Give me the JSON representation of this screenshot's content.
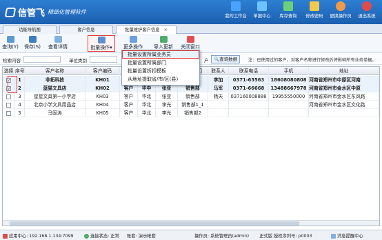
{
  "brand": {
    "name": "信管飞",
    "subtitle": "精细化管理软件"
  },
  "topnav": [
    {
      "label": "我的工作台",
      "icon": "desktop-icon",
      "color": "#4aa3ff"
    },
    {
      "label": "单据中心",
      "icon": "documents-icon",
      "color": "#6cc3ff"
    },
    {
      "label": "库存查询",
      "icon": "stock-icon",
      "color": "#6bd07a"
    },
    {
      "label": "修改密码",
      "icon": "lock-icon",
      "color": "#f2c94c"
    },
    {
      "label": "更换操作员",
      "icon": "user-icon",
      "color": "#f29a4c"
    },
    {
      "label": "退出系统",
      "icon": "exit-icon",
      "color": "#e04b4b"
    }
  ],
  "tabs": [
    {
      "label": "功能导航图"
    },
    {
      "label": "客户信息"
    },
    {
      "label": "批量维护客户信息",
      "close": "×"
    }
  ],
  "toolbar": {
    "query": "查询(Y)",
    "save": "保存(S)",
    "detail": "查看详情",
    "batch": "批量操作",
    "more": "更多操作",
    "import": "导入更新",
    "close": "关闭窗口"
  },
  "dropdown": [
    "批量设置所属业务员",
    "批量设置所属部门",
    "批量设置折扣模板",
    "从地址提取省/市/区(县)"
  ],
  "search": {
    "label_keyword": "检索内容",
    "label_unit": "单位类别",
    "label_dept": "户",
    "query_button": "查询数据",
    "note": "注：已使用过的客户，对客户名称进行修改后将影响所有业务单据。"
  },
  "table": {
    "headers": [
      "选择",
      "序号",
      "客户名称",
      "客户编码",
      "户",
      "",
      "",
      "所属部门",
      "联系人",
      "联系电话",
      "手机",
      "地址"
    ],
    "rows": [
      {
        "checked": true,
        "no": "1",
        "name": "非拓科技",
        "code": "KH01",
        "type": "",
        "area": "",
        "rep": "",
        "dept": "办公室",
        "contact": "李加",
        "phone": "0371-63563",
        "mobile": "18608080808",
        "addr": "河南省郑州市中原区河南",
        "bold": true
      },
      {
        "checked": true,
        "no": "2",
        "name": "蓝猫文具店",
        "code": "KH02",
        "type": "客户",
        "area": "华中",
        "rep": "张亚",
        "dept": "销售部",
        "contact": "马军",
        "phone": "0371-66668",
        "mobile": "13488667978",
        "addr": "河南省郑州市金水区中原",
        "bold": true
      },
      {
        "checked": false,
        "no": "3",
        "name": "星星文具第一小学店",
        "code": "KH03",
        "type": "客户",
        "area": "华北",
        "rep": "张亚",
        "dept": "销售部",
        "contact": "杨天",
        "phone": "037160008888",
        "mobile": "19955550000",
        "addr": "河南省郑州市金水区东风路",
        "bold": false
      },
      {
        "checked": false,
        "no": "4",
        "name": "北京小学文具用品店",
        "code": "KH04",
        "type": "客户",
        "area": "华北",
        "rep": "李光",
        "dept": "销售部1_1",
        "contact": "",
        "phone": "",
        "mobile": "",
        "addr": "河南省郑州市金水区文化路",
        "bold": false
      },
      {
        "checked": false,
        "no": "5",
        "name": "马固涛",
        "code": "KH05",
        "type": "客户",
        "area": "华北",
        "rep": "李光",
        "dept": "销售部2",
        "contact": "",
        "phone": "",
        "mobile": "",
        "addr": "",
        "bold": false
      }
    ]
  },
  "status": {
    "server": "应用中心: 192.168.1.134:7099",
    "conn": "连接状态: 正常",
    "account": "账套: 演示帐套",
    "operator": "操作员: 系统管理员(admin)",
    "version": "正式版 授权序列号: p0003",
    "consult": "消息提醒中心"
  }
}
